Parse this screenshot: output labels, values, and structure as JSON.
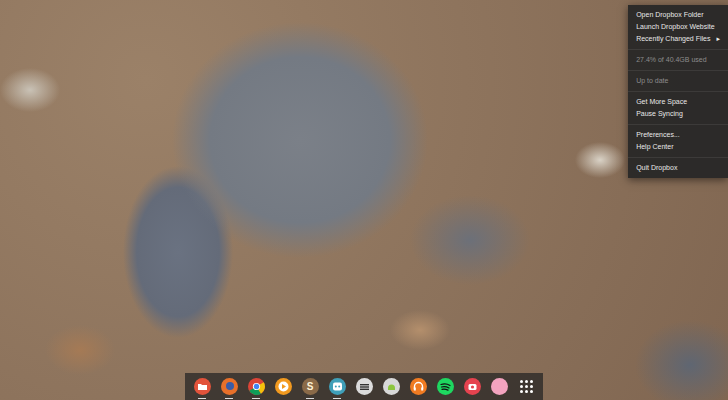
{
  "menu": {
    "groups": [
      [
        {
          "label": "Open Dropbox Folder",
          "disabled": false
        },
        {
          "label": "Launch Dropbox Website",
          "disabled": false
        },
        {
          "label": "Recently Changed Files",
          "disabled": false,
          "arrow": "▸"
        }
      ],
      [
        {
          "label": "27.4% of 40.4GB used",
          "disabled": true
        }
      ],
      [
        {
          "label": "Up to date",
          "disabled": true
        }
      ],
      [
        {
          "label": "Get More Space",
          "disabled": false
        },
        {
          "label": "Pause Syncing",
          "disabled": false
        }
      ],
      [
        {
          "label": "Preferences...",
          "disabled": false
        },
        {
          "label": "Help Center",
          "disabled": false
        }
      ],
      [
        {
          "label": "Quit Dropbox",
          "disabled": false
        }
      ]
    ]
  },
  "dock": {
    "apps": [
      {
        "color": "#e2533b",
        "active": true
      },
      {
        "color": "#e8702a",
        "active": true
      },
      {
        "color": "#f2c01e",
        "active": true
      },
      {
        "color": "#f29a1f",
        "active": false
      },
      {
        "color": "#8a6a48",
        "active": true,
        "label": "S"
      },
      {
        "color": "#3f9fb8",
        "active": true
      },
      {
        "color": "#dcdcdc",
        "active": false
      },
      {
        "color": "#8dc63f",
        "active": false
      },
      {
        "color": "#f07b22",
        "active": false
      },
      {
        "color": "#1ed760",
        "active": false
      },
      {
        "color": "#e5434f",
        "active": false
      },
      {
        "color": "#f3a3bf",
        "active": false
      },
      {
        "color": "#ffffff",
        "active": false
      }
    ]
  }
}
